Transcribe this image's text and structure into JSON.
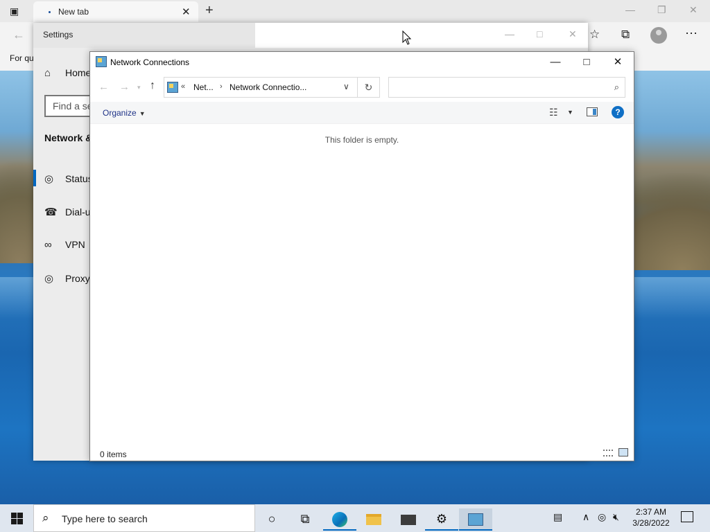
{
  "browser": {
    "tab_title": "New tab",
    "favorites_bar_text": "For qu"
  },
  "settings": {
    "title": "Settings",
    "home_label": "Home",
    "search_placeholder": "Find a se",
    "heading": "Network &",
    "nav_items": [
      {
        "label": "Status",
        "icon": "globe-icon"
      },
      {
        "label": "Dial-u",
        "icon": "dialup-icon"
      },
      {
        "label": "VPN",
        "icon": "vpn-icon"
      },
      {
        "label": "Proxy",
        "icon": "globe-icon"
      }
    ]
  },
  "explorer": {
    "title": "Network Connections",
    "breadcrumb": {
      "overflow": "«",
      "segments": [
        "Net...",
        "Network Connectio..."
      ]
    },
    "search_placeholder": "",
    "organize_label": "Organize",
    "empty_message": "This folder is empty.",
    "status_text": "0 items"
  },
  "taskbar": {
    "search_placeholder": "Type here to search",
    "clock_time": "2:37 AM",
    "clock_date": "3/28/2022"
  },
  "colors": {
    "accent": "#0067c0",
    "help_button": "#0f6fc5"
  }
}
